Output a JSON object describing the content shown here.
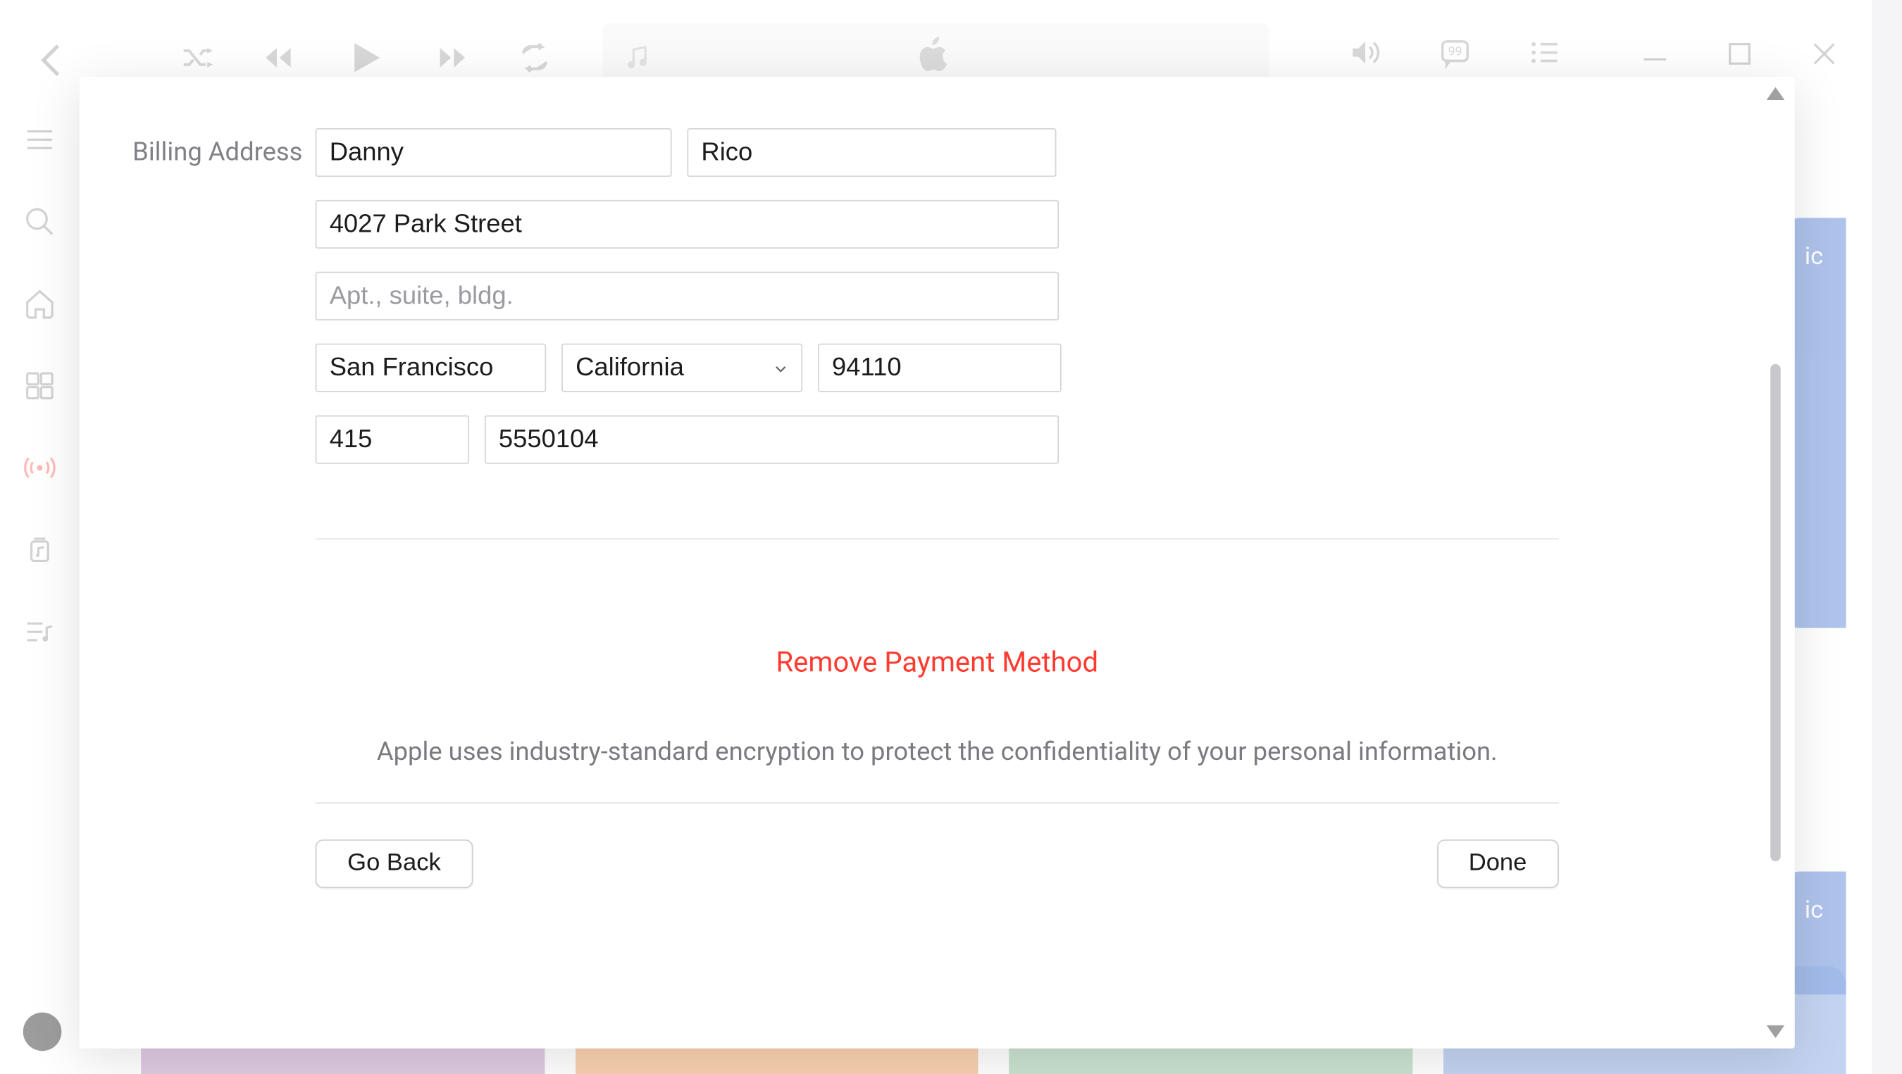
{
  "form": {
    "section_label": "Billing Address",
    "first_name": "Danny",
    "last_name": "Rico",
    "street": "4027 Park Street",
    "apt_placeholder": "Apt., suite, bldg.",
    "apt": "",
    "city": "San Francisco",
    "state": "California",
    "zip": "94110",
    "area_code": "415",
    "phone": "5550104"
  },
  "actions": {
    "remove": "Remove Payment Method",
    "note": "Apple uses industry-standard encryption to protect the confidentiality of your personal information.",
    "back": "Go Back",
    "done": "Done"
  },
  "side_label": "ic"
}
